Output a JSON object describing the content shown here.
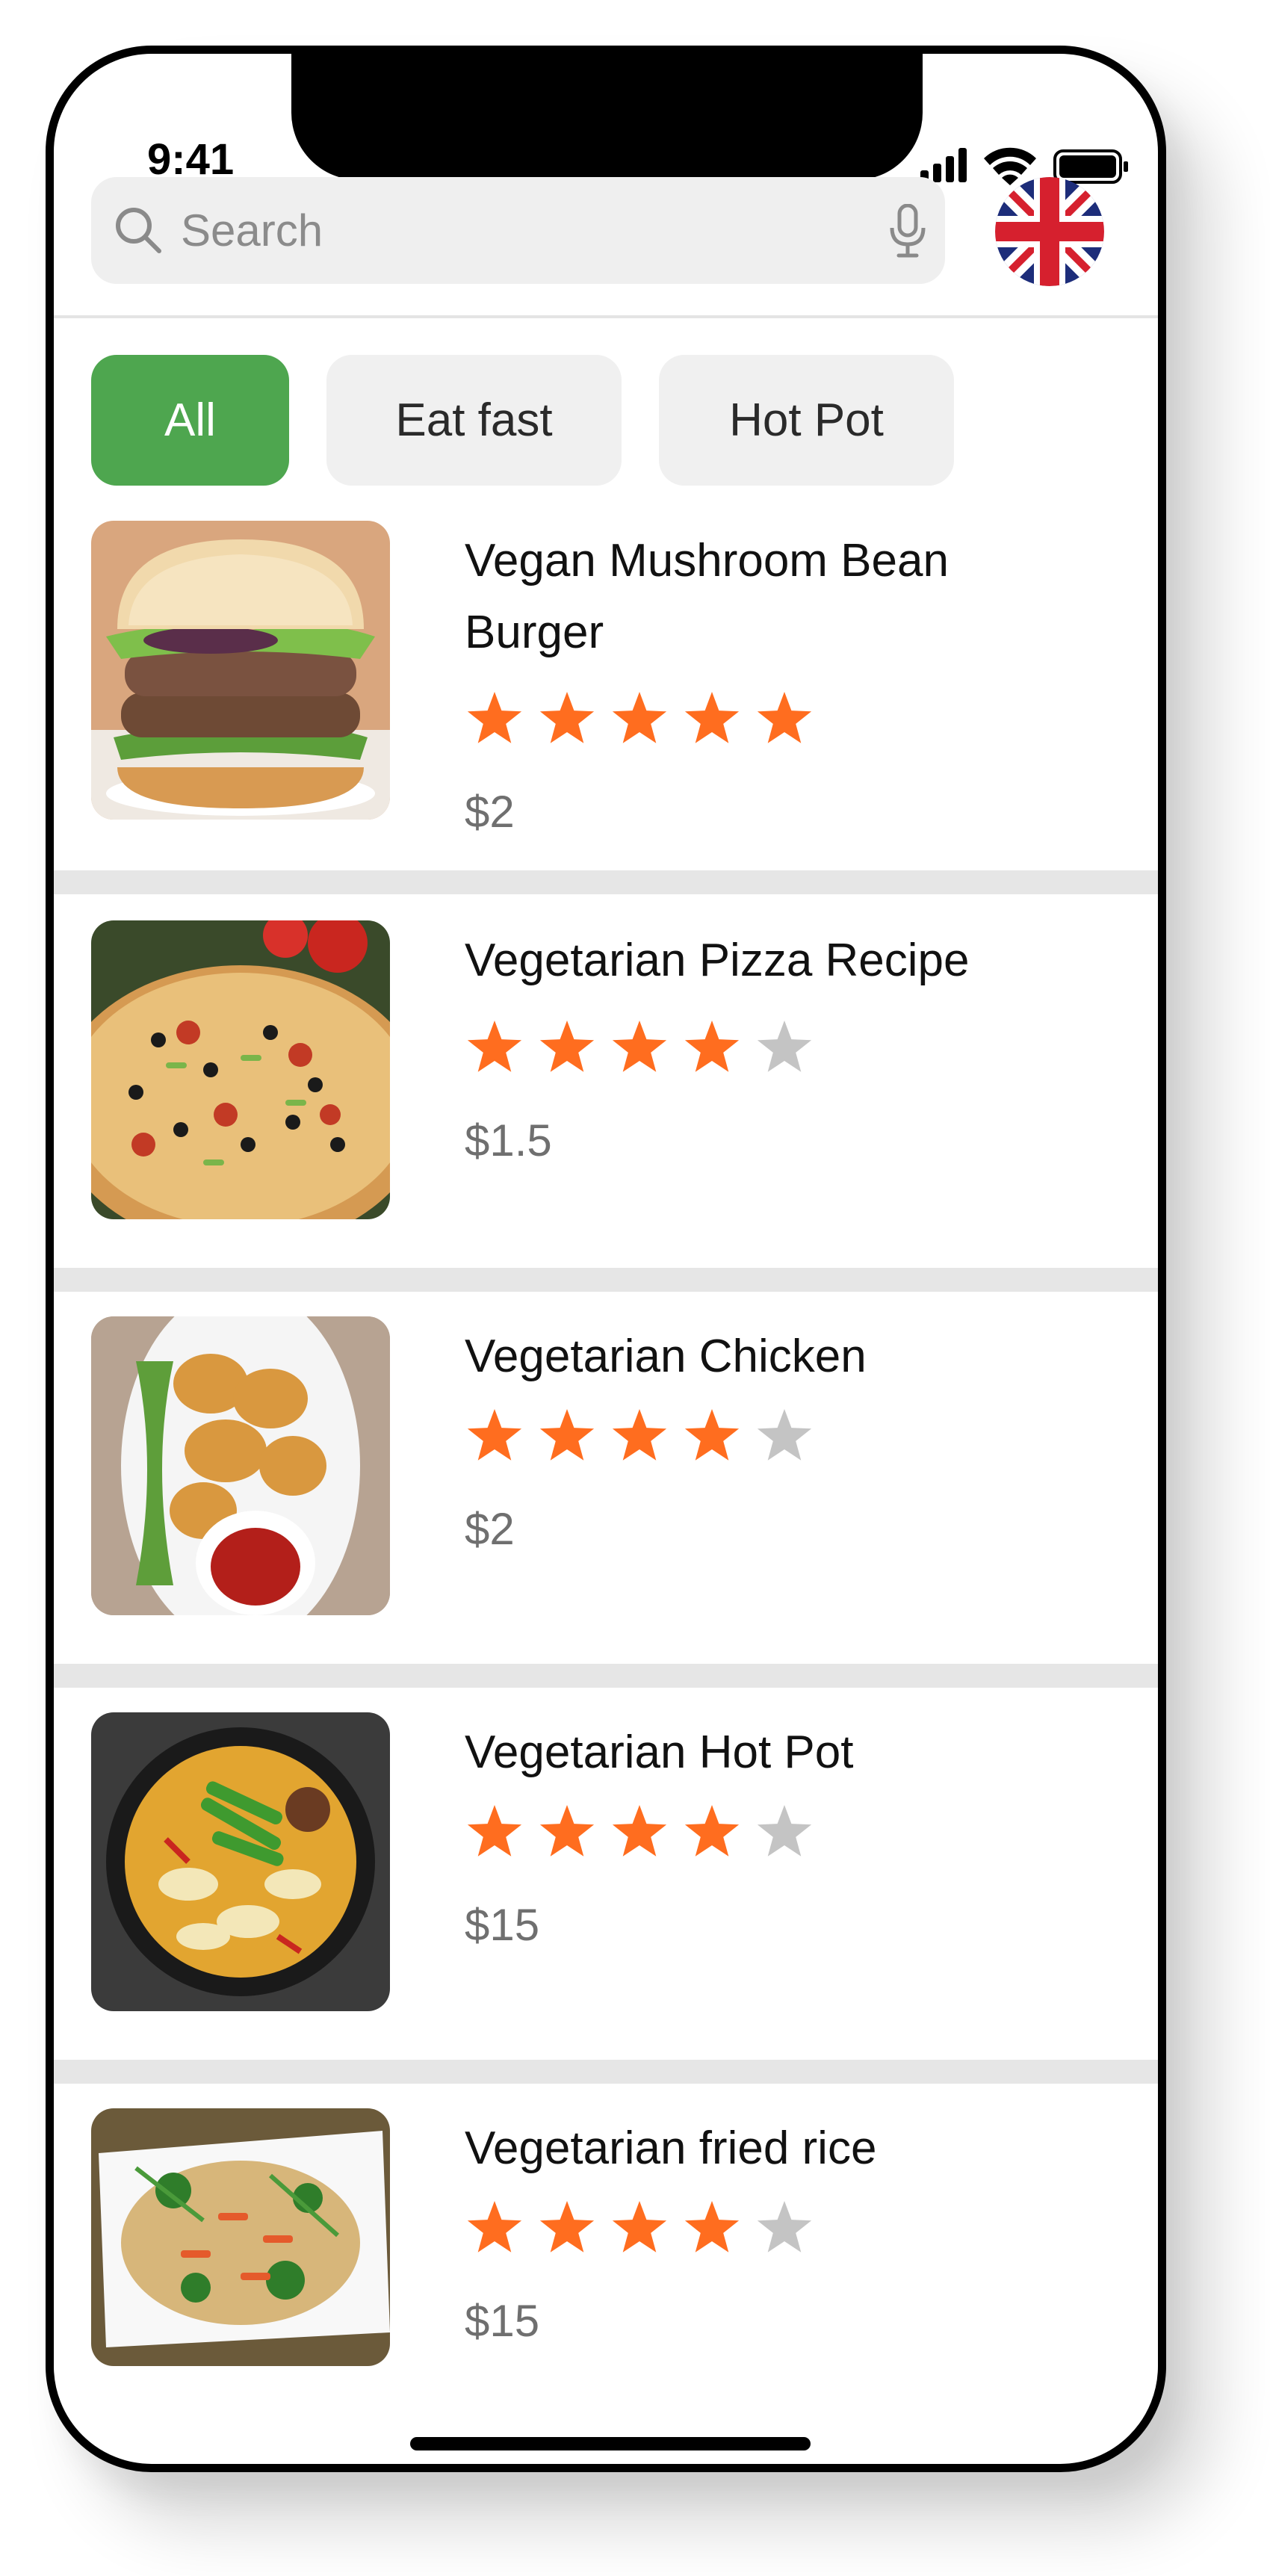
{
  "status_bar": {
    "time": "9:41"
  },
  "search": {
    "placeholder": "Search",
    "language_flag": "united-kingdom-flag-icon"
  },
  "filters": [
    {
      "label": "All",
      "selected": true
    },
    {
      "label": "Eat fast",
      "selected": false
    },
    {
      "label": "Hot Pot",
      "selected": false
    }
  ],
  "items": [
    {
      "name": "Vegan Mushroom Bean Burger",
      "rating": 5,
      "price": "$2"
    },
    {
      "name": "Vegetarian Pizza Recipe",
      "rating": 4,
      "price": "$1.5"
    },
    {
      "name": "Vegetarian Chicken",
      "rating": 4,
      "price": "$2"
    },
    {
      "name": "Vegetarian Hot Pot",
      "rating": 4,
      "price": "$15"
    },
    {
      "name": "Vegetarian fried rice",
      "rating": 4,
      "price": "$15"
    }
  ],
  "colors": {
    "accent": "#4ea64f",
    "star_filled": "#ff6d1f",
    "star_empty": "#c4c4c4"
  }
}
